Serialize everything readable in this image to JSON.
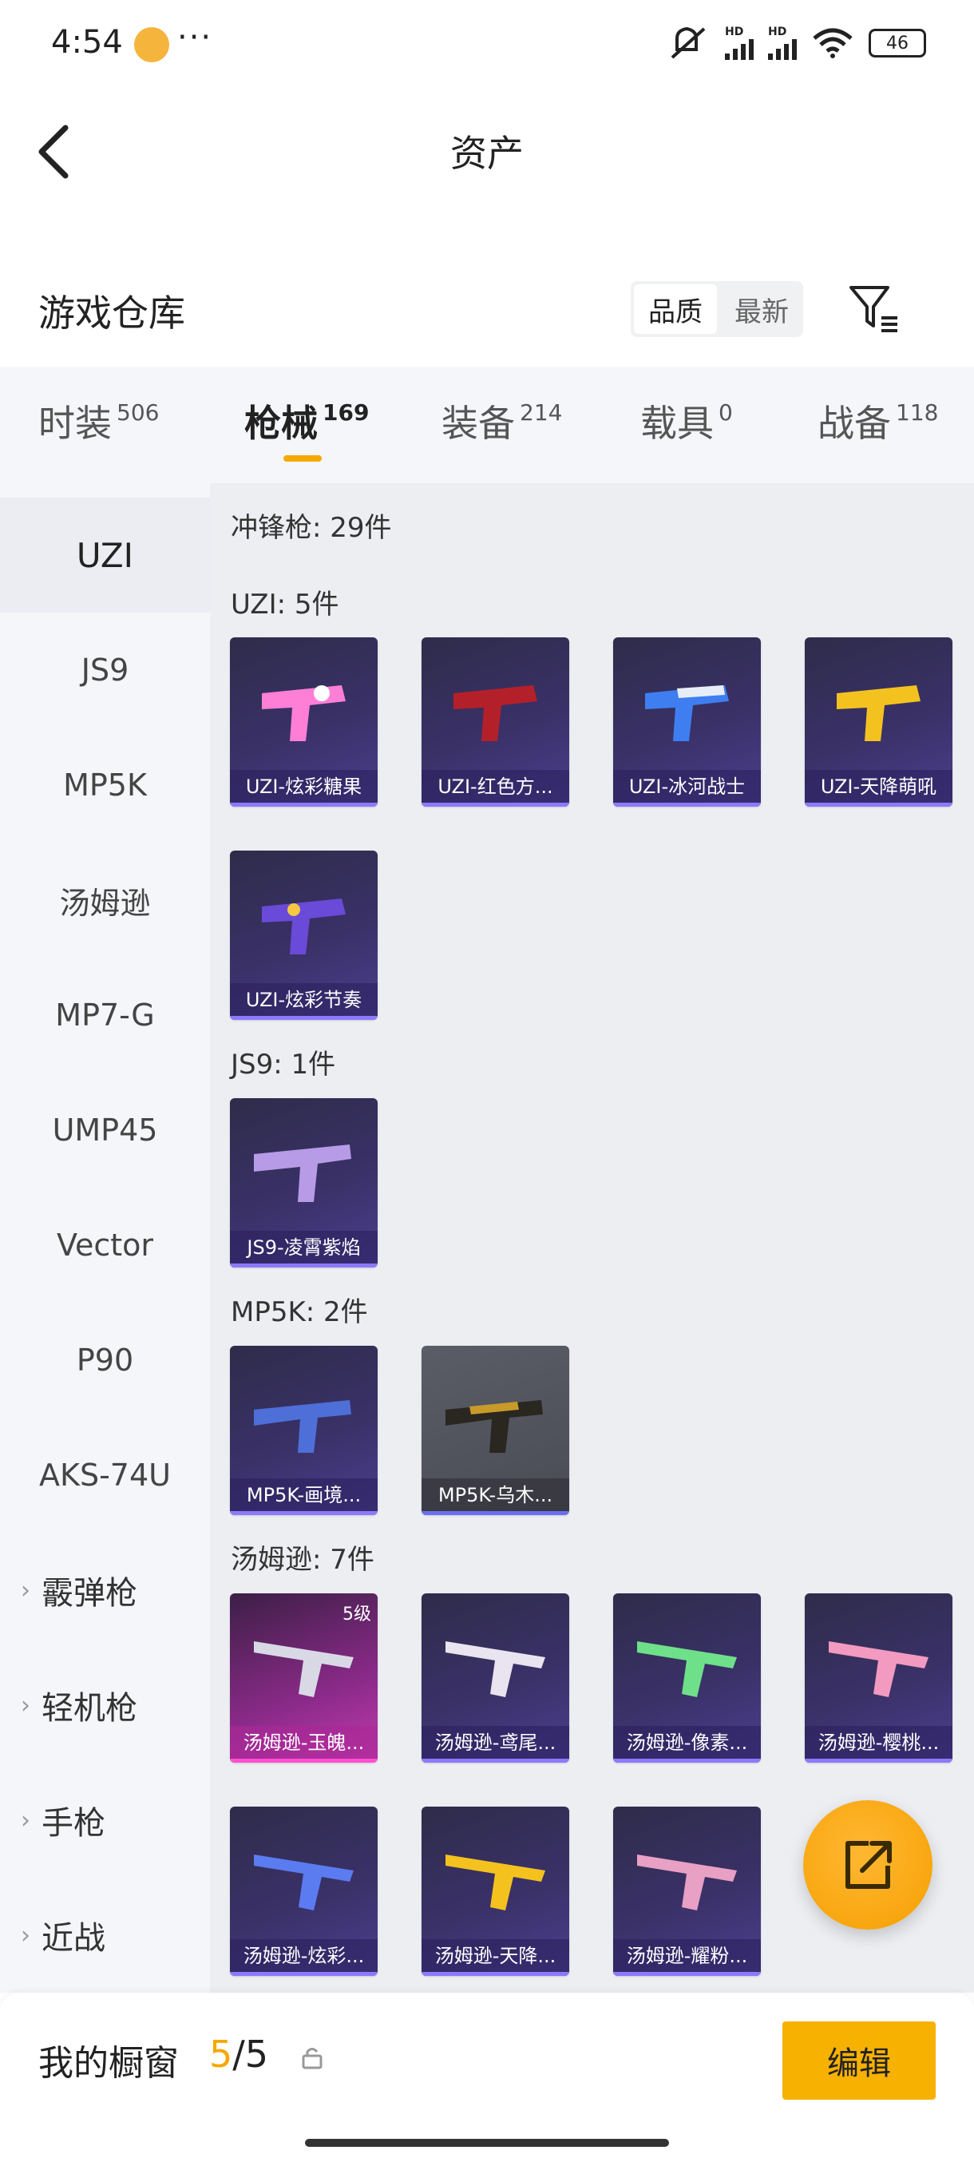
{
  "status": {
    "time": "4:54",
    "more": "···",
    "battery": "46",
    "hd1": "HD",
    "hd2": "HD"
  },
  "header": {
    "title": "资产"
  },
  "warehouse": {
    "title": "游戏仓库",
    "sort_quality": "品质",
    "sort_newest": "最新"
  },
  "tabs": [
    {
      "label": "时装",
      "count": "506"
    },
    {
      "label": "枪械",
      "count": "169"
    },
    {
      "label": "装备",
      "count": "214"
    },
    {
      "label": "载具",
      "count": "0"
    },
    {
      "label": "战备",
      "count": "118"
    }
  ],
  "sidebar": {
    "items": [
      "UZI",
      "JS9",
      "MP5K",
      "汤姆逊",
      "MP7-G",
      "UMP45",
      "Vector",
      "P90",
      "AKS-74U"
    ],
    "groups": [
      "霰弹枪",
      "轻机枪",
      "手枪",
      "近战"
    ]
  },
  "content": {
    "category_header": "冲锋枪: 29件",
    "sections": [
      {
        "label": "UZI: 5件",
        "items": [
          "UZI-炫彩糖果",
          "UZI-红色方...",
          "UZI-冰河战士",
          "UZI-天降萌吼",
          "UZI-炫彩节奏"
        ]
      },
      {
        "label": "JS9: 1件",
        "items": [
          "JS9-凌霄紫焰"
        ]
      },
      {
        "label": "MP5K: 2件",
        "items": [
          "MP5K-画境...",
          "MP5K-乌木..."
        ]
      },
      {
        "label": "汤姆逊: 7件",
        "items": [
          "汤姆逊-玉魄...",
          "汤姆逊-鸢尾...",
          "汤姆逊-像素...",
          "汤姆逊-樱桃...",
          "汤姆逊-炫彩...",
          "汤姆逊-天降...",
          "汤姆逊-耀粉..."
        ]
      }
    ],
    "level_badge": "5级"
  },
  "bottom": {
    "label": "我的橱窗",
    "count_current": "5",
    "count_sep": "/",
    "count_total": "5",
    "edit_label": "编辑"
  },
  "colors": {
    "accent": "#f5a800",
    "card_purple": "#3a3168",
    "card_pink": "#c23bb0",
    "card_gray": "#555761"
  }
}
